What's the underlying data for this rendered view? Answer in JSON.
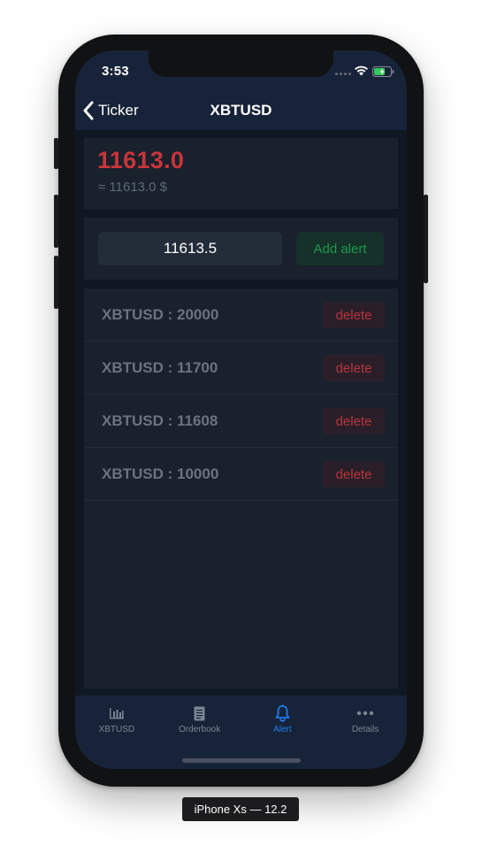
{
  "status_bar": {
    "time": "3:53"
  },
  "nav": {
    "back_label": "Ticker",
    "title": "XBTUSD"
  },
  "price": {
    "value": "11613.0",
    "approx": "≈ 11613.0 $"
  },
  "alert_form": {
    "input_value": "11613.5",
    "add_label": "Add alert"
  },
  "alerts": [
    {
      "label": "XBTUSD : 20000",
      "delete_label": "delete"
    },
    {
      "label": "XBTUSD : 11700",
      "delete_label": "delete"
    },
    {
      "label": "XBTUSD : 11608",
      "delete_label": "delete"
    },
    {
      "label": "XBTUSD : 10000",
      "delete_label": "delete"
    }
  ],
  "tabs": [
    {
      "label": "XBTUSD",
      "icon": "bar-chart-icon",
      "active": false
    },
    {
      "label": "Orderbook",
      "icon": "document-icon",
      "active": false
    },
    {
      "label": "Alert",
      "icon": "bell-icon",
      "active": true
    },
    {
      "label": "Details",
      "icon": "more-dots-icon",
      "active": false
    }
  ],
  "device_label": "iPhone Xs — 12.2",
  "colors": {
    "price_red": "#c8353b",
    "add_green": "#1d9a4c",
    "delete_red": "#b9343c",
    "active_tab_blue": "#1d7cf2",
    "nav_bg": "#172338",
    "card_bg": "#18212c"
  }
}
